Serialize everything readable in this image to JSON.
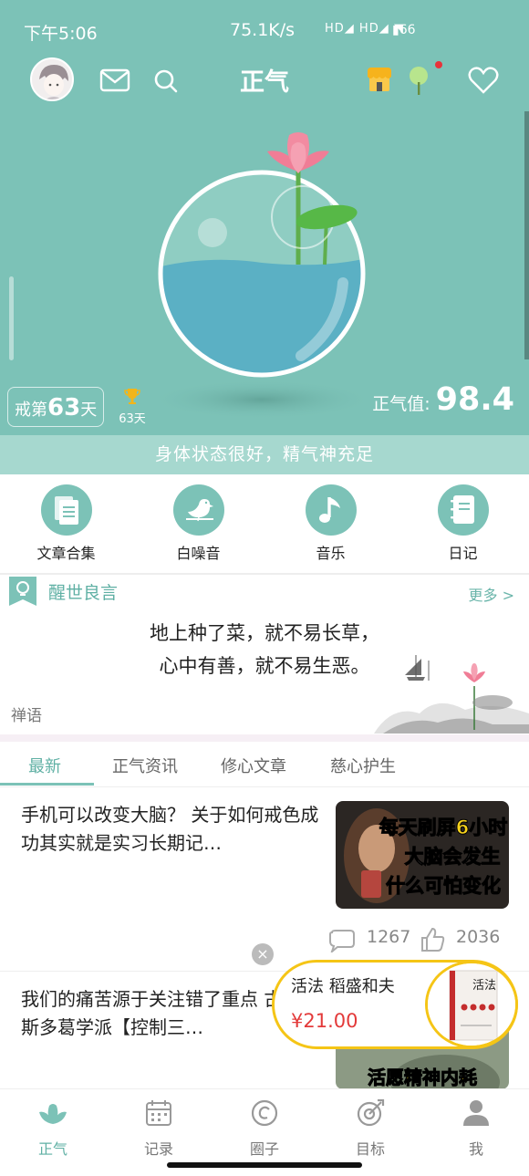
{
  "status": {
    "time": "下午5:06",
    "net_speed": "75.1K/s",
    "signal_icons": "HD◢ HD◢ ◥",
    "battery": "66"
  },
  "appbar": {
    "title": "正气",
    "icons": [
      "avatar",
      "mail-icon",
      "search-icon",
      "shop-icon",
      "tree-icon",
      "heart-icon"
    ]
  },
  "hero": {
    "days_prefix": "戒第",
    "days_value": "63",
    "days_suffix": "天",
    "trophy_days": "63天",
    "score_label": "正气值:",
    "score_value": "98.4",
    "status_text": "身体状态很好，精气神充足",
    "colors": {
      "teal": "#7cc2b7",
      "water": "#5bb0c4",
      "lotus": "#f07d96",
      "leaf": "#57b847"
    }
  },
  "features": [
    {
      "label": "文章合集",
      "icon": "document-icon"
    },
    {
      "label": "白噪音",
      "icon": "bird-icon"
    },
    {
      "label": "音乐",
      "icon": "music-note-icon"
    },
    {
      "label": "日记",
      "icon": "notebook-icon"
    }
  ],
  "quote": {
    "title": "醒世良言",
    "more": "更多 >",
    "line1": "地上种了菜，就不易长草，",
    "line2": "心中有善，就不易生恶。",
    "category": "禅语"
  },
  "tabs": [
    {
      "label": "最新",
      "active": true
    },
    {
      "label": "正气资讯",
      "active": false
    },
    {
      "label": "修心文章",
      "active": false
    },
    {
      "label": "慈心护生",
      "active": false
    }
  ],
  "articles": [
    {
      "title": "手机可以改变大脑？ 关于如何戒色成功其实就是实习长期记…",
      "thumb_text": [
        "每天刷屏6小时",
        "大脑会发生",
        "什么可怕变化"
      ],
      "comments": "1267",
      "likes": "2036"
    },
    {
      "title": "我们的痛苦源于关注错了重点 古希腊斯多葛学派【控制三…",
      "thumb_text": [
        "活愿精神内耗"
      ]
    }
  ],
  "promo": {
    "name": "活法  稻盛和夫",
    "price": "¥21.00",
    "book_title": "活法",
    "close": "×"
  },
  "bottom_nav": [
    {
      "label": "正气",
      "icon": "lotus-icon",
      "active": true
    },
    {
      "label": "记录",
      "icon": "calendar-icon",
      "active": false
    },
    {
      "label": "圈子",
      "icon": "circle-icon",
      "active": false
    },
    {
      "label": "目标",
      "icon": "target-icon",
      "active": false
    },
    {
      "label": "我",
      "icon": "user-icon",
      "active": false
    }
  ]
}
